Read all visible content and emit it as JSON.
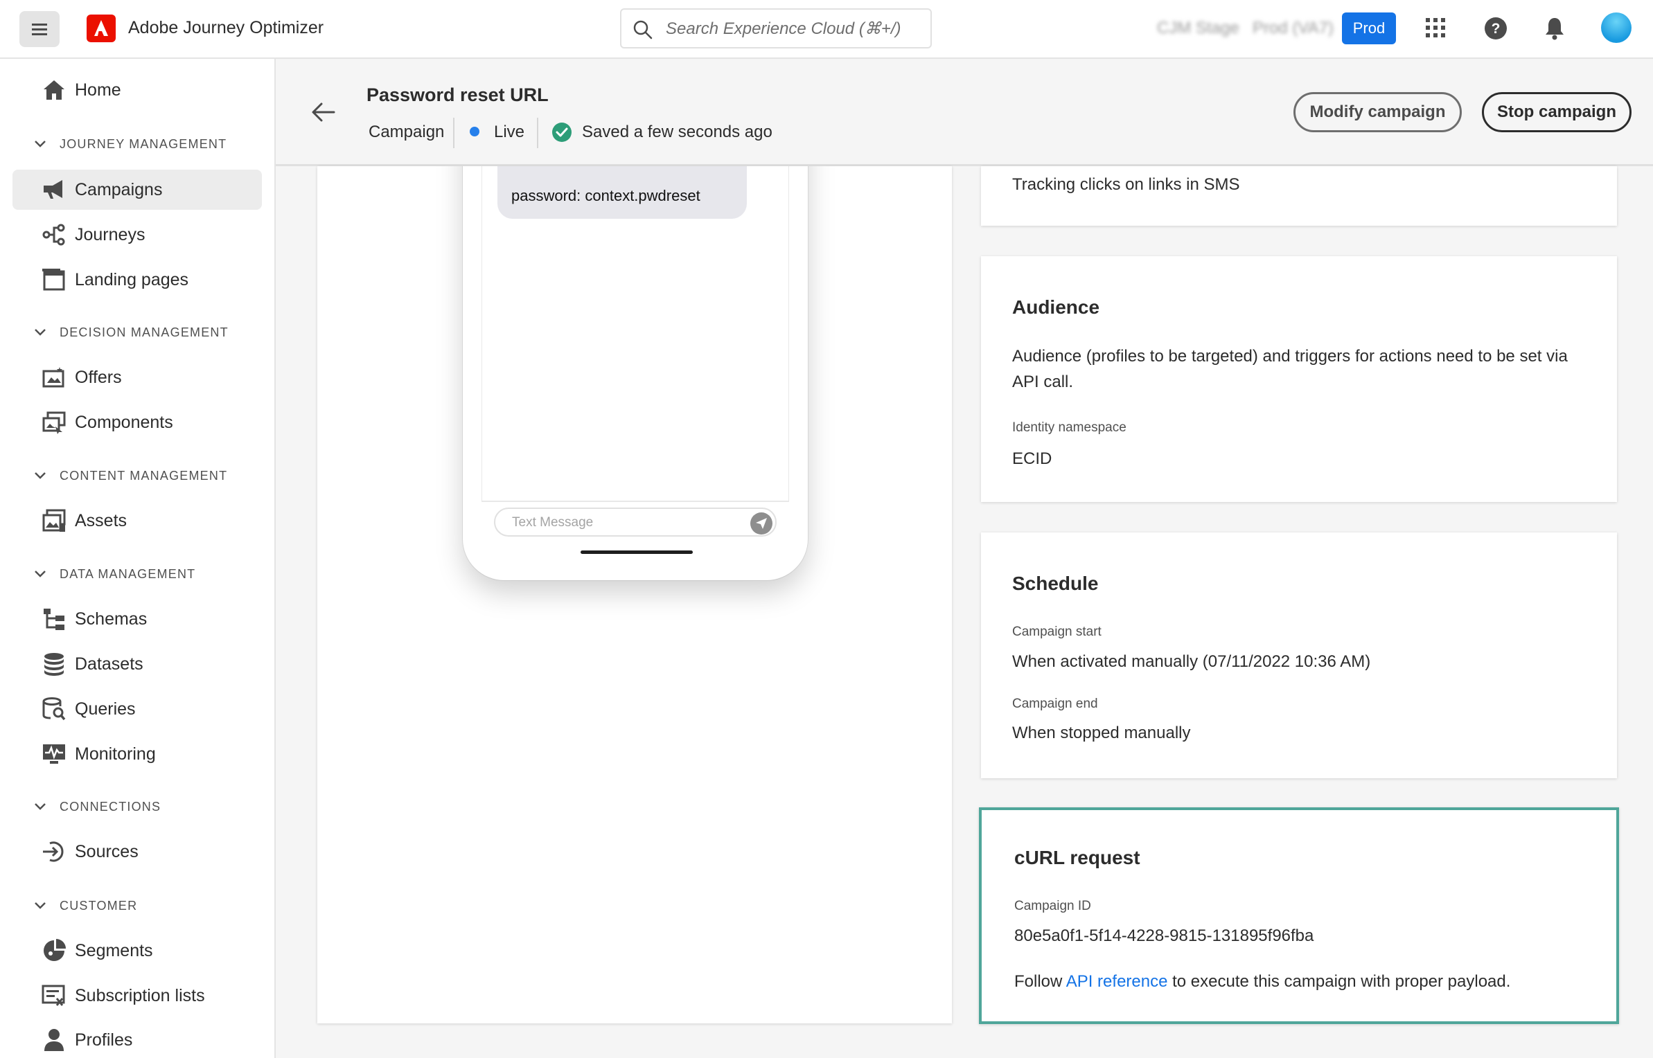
{
  "app": {
    "title": "Adobe Journey Optimizer",
    "search_placeholder": "Search Experience Cloud (⌘+/)",
    "env_org": "CJM Stage",
    "env_sandbox": "Prod (VA7)",
    "env_button": "Prod",
    "brand_color": "#eb1000",
    "accent_color": "#1473e6"
  },
  "sidebar": {
    "home": "Home",
    "sections": {
      "journey": "JOURNEY MANAGEMENT",
      "decision": "DECISION MANAGEMENT",
      "content": "CONTENT MANAGEMENT",
      "data": "DATA MANAGEMENT",
      "connections": "CONNECTIONS",
      "customer": "CUSTOMER"
    },
    "items": {
      "campaigns": "Campaigns",
      "journeys": "Journeys",
      "landing_pages": "Landing pages",
      "offers": "Offers",
      "components": "Components",
      "assets": "Assets",
      "schemas": "Schemas",
      "datasets": "Datasets",
      "queries": "Queries",
      "monitoring": "Monitoring",
      "sources": "Sources",
      "segments": "Segments",
      "subscription_lists": "Subscription lists",
      "profiles": "Profiles"
    }
  },
  "header": {
    "title": "Password reset URL",
    "type": "Campaign",
    "status": "Live",
    "saved": "Saved a few seconds ago",
    "modify_button": "Modify campaign",
    "stop_button": "Stop campaign"
  },
  "preview": {
    "message_text": "password: context.pwdreset",
    "input_placeholder": "Text Message"
  },
  "cards": {
    "tracking_text": "Tracking clicks on links in SMS",
    "audience": {
      "title": "Audience",
      "description": "Audience (profiles to be targeted) and triggers for actions need to be set via API call.",
      "namespace_label": "Identity namespace",
      "namespace_value": "ECID"
    },
    "schedule": {
      "title": "Schedule",
      "start_label": "Campaign start",
      "start_value": "When activated manually (07/11/2022 10:36 AM)",
      "end_label": "Campaign end",
      "end_value": "When stopped manually"
    },
    "curl": {
      "title": "cURL request",
      "id_label": "Campaign ID",
      "id_value": "80e5a0f1-5f14-4228-9815-131895f96fba",
      "follow_prefix": "Follow",
      "link_text": "API reference",
      "follow_suffix": "to execute this campaign with proper payload."
    }
  }
}
